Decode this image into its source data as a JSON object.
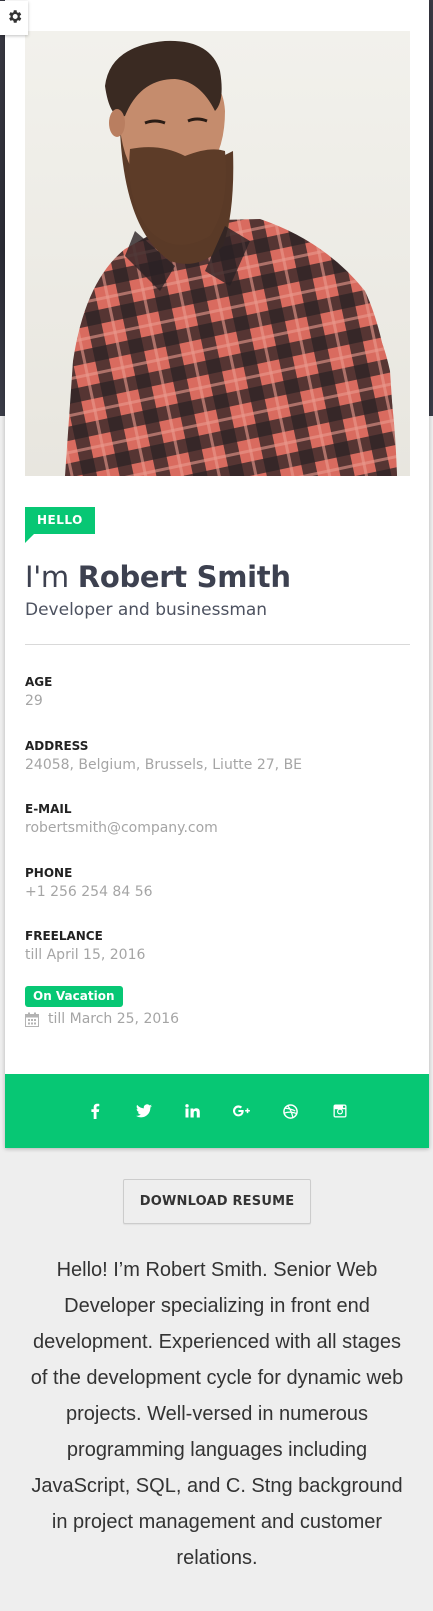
{
  "profile": {
    "greeting": "HELLO",
    "name_prefix": "I'm ",
    "name": "Robert Smith",
    "role": "Developer and businessman"
  },
  "info": [
    {
      "label": "AGE",
      "value": "29"
    },
    {
      "label": "ADDRESS",
      "value": "24058, Belgium, Brussels, Liutte 27, BE"
    },
    {
      "label": "E-MAIL",
      "value": "robertsmith@company.com"
    },
    {
      "label": "PHONE",
      "value": "+1 256 254 84 56"
    },
    {
      "label": "FREELANCE",
      "value": "till April 15, 2016"
    }
  ],
  "status": {
    "badge": "On Vacation",
    "until": "till March 25, 2016",
    "icon": "calendar-icon"
  },
  "social": [
    {
      "name": "facebook-icon",
      "glyph": "f"
    },
    {
      "name": "twitter-icon",
      "glyph": "t"
    },
    {
      "name": "linkedin-icon",
      "glyph": "in"
    },
    {
      "name": "google-plus-icon",
      "glyph": "g+"
    },
    {
      "name": "dribbble-icon",
      "glyph": "db"
    },
    {
      "name": "instagram-icon",
      "glyph": "ig"
    }
  ],
  "actions": {
    "download_label": "DOWNLOAD RESUME"
  },
  "bio": "Hello! I’m Robert Smith. Senior Web Developer specializing in front end development. Experienced with all stages of the development cycle for dynamic web projects. Well-versed in numerous programming languages including JavaScript, SQL, and C. Stng background in project management and customer relations.",
  "colors": {
    "accent": "#07c774",
    "page_bg": "#eeeeee",
    "dark_header": "#2b2c35"
  }
}
